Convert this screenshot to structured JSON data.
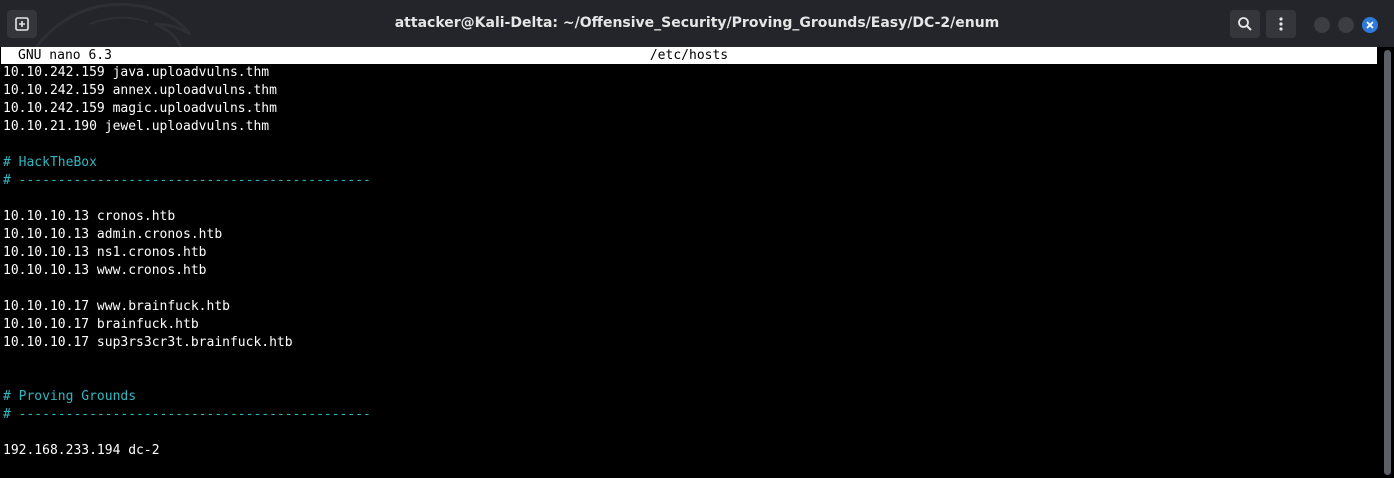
{
  "window": {
    "title": "attacker@Kali-Delta: ~/Offensive_Security/Proving_Grounds/Easy/DC-2/enum",
    "icons": {
      "new_tab": "new-tab-icon",
      "search": "search-icon",
      "menu": "vertical-dots-menu-icon",
      "minimize": "minimize-icon",
      "maximize": "maximize-icon",
      "close": "close-icon"
    },
    "colors": {
      "titlebar": "#23252b",
      "close_button": "#2e7ad9",
      "comment": "#2fb7c2"
    }
  },
  "nano": {
    "version": "GNU nano 6.3",
    "filename": "/etc/hosts"
  },
  "lines": [
    {
      "text": "10.10.242.159 java.uploadvulns.thm",
      "comment": false
    },
    {
      "text": "10.10.242.159 annex.uploadvulns.thm",
      "comment": false
    },
    {
      "text": "10.10.242.159 magic.uploadvulns.thm",
      "comment": false
    },
    {
      "text": "10.10.21.190 jewel.uploadvulns.thm",
      "comment": false
    },
    {
      "text": "",
      "comment": false
    },
    {
      "text": "# HackTheBox",
      "comment": true
    },
    {
      "text": "# ---------------------------------------------",
      "comment": true
    },
    {
      "text": "",
      "comment": false
    },
    {
      "text": "10.10.10.13 cronos.htb",
      "comment": false
    },
    {
      "text": "10.10.10.13 admin.cronos.htb",
      "comment": false
    },
    {
      "text": "10.10.10.13 ns1.cronos.htb",
      "comment": false
    },
    {
      "text": "10.10.10.13 www.cronos.htb",
      "comment": false
    },
    {
      "text": "",
      "comment": false
    },
    {
      "text": "10.10.10.17 www.brainfuck.htb",
      "comment": false
    },
    {
      "text": "10.10.10.17 brainfuck.htb",
      "comment": false
    },
    {
      "text": "10.10.10.17 sup3rs3cr3t.brainfuck.htb",
      "comment": false
    },
    {
      "text": "",
      "comment": false
    },
    {
      "text": "",
      "comment": false
    },
    {
      "text": "# Proving Grounds",
      "comment": true
    },
    {
      "text": "# ---------------------------------------------",
      "comment": true
    },
    {
      "text": "",
      "comment": false
    },
    {
      "text": "192.168.233.194 dc-2",
      "comment": false
    }
  ]
}
